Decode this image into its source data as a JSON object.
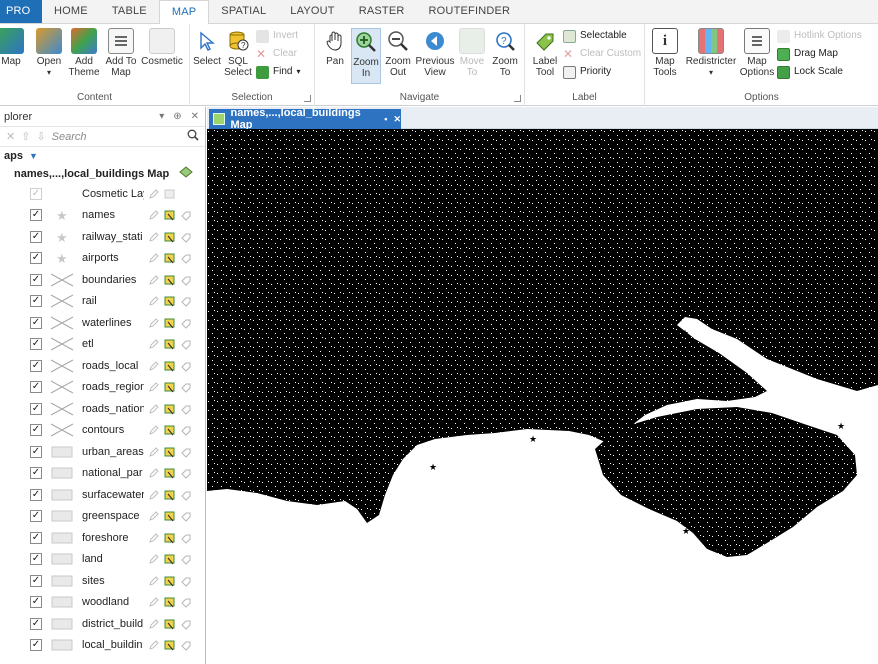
{
  "tabs": [
    {
      "label": "PRO",
      "kind": "pro"
    },
    {
      "label": "HOME",
      "kind": ""
    },
    {
      "label": "TABLE",
      "kind": ""
    },
    {
      "label": "MAP",
      "kind": "active"
    },
    {
      "label": "SPATIAL",
      "kind": ""
    },
    {
      "label": "LAYOUT",
      "kind": ""
    },
    {
      "label": "RASTER",
      "kind": ""
    },
    {
      "label": "ROUTEFINDER",
      "kind": ""
    }
  ],
  "ribbon": {
    "content": {
      "label": "Content",
      "map": "Map",
      "open": "Open",
      "add_theme": "Add\nTheme",
      "add_to_map": "Add To\nMap",
      "cosmetic": "Cosmetic"
    },
    "selection": {
      "label": "Selection",
      "select": "Select",
      "sql_select": "SQL\nSelect",
      "invert": "Invert",
      "clear": "Clear",
      "find": "Find"
    },
    "navigate": {
      "label": "Navigate",
      "pan": "Pan",
      "zoom_in": "Zoom\nIn",
      "zoom_out": "Zoom\nOut",
      "previous_view": "Previous\nView",
      "move_to": "Move\nTo",
      "zoom_to": "Zoom\nTo"
    },
    "label_group": {
      "label": "Label",
      "label_tool": "Label\nTool",
      "selectable": "Selectable",
      "clear_custom": "Clear Custom",
      "priority": "Priority"
    },
    "options": {
      "label": "Options",
      "map_tools": "Map\nTools",
      "redistricter": "Redistricter",
      "map_options": "Map\nOptions",
      "hotlink_options": "Hotlink Options",
      "drag_map": "Drag Map",
      "lock_scale": "Lock Scale"
    }
  },
  "explorer": {
    "title": "plorer",
    "search_placeholder": "Search",
    "maps_heading": "aps",
    "map_name": "names,...,local_buildings Map",
    "layers": [
      {
        "name": "Cosmetic Lay",
        "sym": "none",
        "checked": true,
        "dim": true
      },
      {
        "name": "names",
        "sym": "star",
        "checked": true,
        "dim": false
      },
      {
        "name": "railway_stati",
        "sym": "star",
        "checked": true,
        "dim": false
      },
      {
        "name": "airports",
        "sym": "star",
        "checked": true,
        "dim": false
      },
      {
        "name": "boundaries",
        "sym": "line",
        "checked": true,
        "dim": false
      },
      {
        "name": "rail",
        "sym": "line",
        "checked": true,
        "dim": false
      },
      {
        "name": "waterlines",
        "sym": "line",
        "checked": true,
        "dim": false
      },
      {
        "name": "etl",
        "sym": "line",
        "checked": true,
        "dim": false
      },
      {
        "name": "roads_local",
        "sym": "line",
        "checked": true,
        "dim": false
      },
      {
        "name": "roads_region",
        "sym": "line",
        "checked": true,
        "dim": false
      },
      {
        "name": "roads_nation",
        "sym": "line",
        "checked": true,
        "dim": false
      },
      {
        "name": "contours",
        "sym": "line",
        "checked": true,
        "dim": false
      },
      {
        "name": "urban_areas",
        "sym": "region",
        "checked": true,
        "dim": false
      },
      {
        "name": "national_par",
        "sym": "region",
        "checked": true,
        "dim": false
      },
      {
        "name": "surfacewater",
        "sym": "region",
        "checked": true,
        "dim": false
      },
      {
        "name": "greenspace",
        "sym": "region",
        "checked": true,
        "dim": false
      },
      {
        "name": "foreshore",
        "sym": "region",
        "checked": true,
        "dim": false
      },
      {
        "name": "land",
        "sym": "region",
        "checked": true,
        "dim": false
      },
      {
        "name": "sites",
        "sym": "region",
        "checked": true,
        "dim": false
      },
      {
        "name": "woodland",
        "sym": "region",
        "checked": true,
        "dim": false
      },
      {
        "name": "district_build",
        "sym": "region",
        "checked": true,
        "dim": false
      },
      {
        "name": "local_buildin",
        "sym": "region",
        "checked": true,
        "dim": false
      }
    ]
  },
  "map_tab": {
    "title": "names,...,local_buildings Map"
  },
  "colors": {
    "accent": "#1f6fb7",
    "map_tab": "#2e72c2",
    "land_fill": "#000000",
    "water": "#ffffff"
  }
}
